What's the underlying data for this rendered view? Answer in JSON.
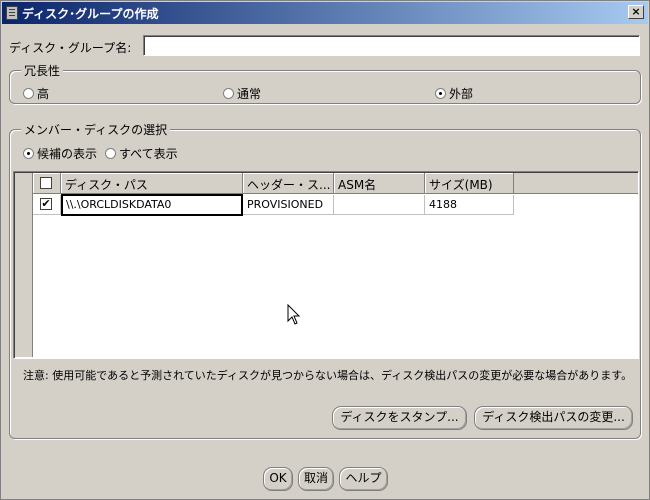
{
  "window": {
    "title": "ディスク･グループの作成",
    "close_glyph": "×"
  },
  "diskgroup": {
    "name_label": "ディスク・グループ名:",
    "name_value": ""
  },
  "redundancy": {
    "title": "冗長性",
    "options": [
      {
        "label": "高",
        "selected": false
      },
      {
        "label": "通常",
        "selected": false
      },
      {
        "label": "外部",
        "selected": true
      }
    ]
  },
  "member": {
    "title": "メンバー・ディスクの選択",
    "filter_options": [
      {
        "label": "候補の表示",
        "selected": true
      },
      {
        "label": "すべて表示",
        "selected": false
      }
    ]
  },
  "table": {
    "columns": [
      "",
      "ディスク・パス",
      "ヘッダー・ス...",
      "ASM名",
      "サイズ(MB)"
    ],
    "rows": [
      {
        "checked": true,
        "path": "\\\\.\\ORCLDISKDATA0",
        "header_status": "PROVISIONED",
        "asm_name": "",
        "size_mb": "4188"
      }
    ]
  },
  "note": "注意: 使用可能であると予測されていたディスクが見つからない場合は、ディスク検出パスの変更が必要な場合があります。",
  "buttons": {
    "stamp": "ディスクをスタンプ...",
    "change_path": "ディスク検出パスの変更...",
    "ok": "OK",
    "cancel": "取消",
    "help": "ヘルプ"
  }
}
